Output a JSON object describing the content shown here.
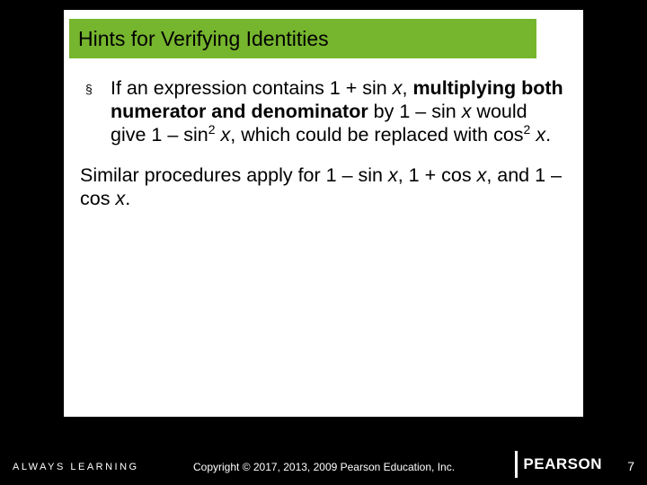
{
  "title": "Hints for Verifying Identities",
  "bullet": {
    "lead": "If an expression contains 1 + sin ",
    "var1": "x",
    "after1": ", ",
    "bold": "multiplying both numerator and denominator",
    "mid": " by 1 – sin ",
    "var2": "x",
    "after2": " would give 1 – sin",
    "sup1": "2",
    "sp1": " ",
    "var3": "x",
    "after3": ", which could be replaced with cos",
    "sup2": "2",
    "sp2": " ",
    "var4": "x",
    "end": "."
  },
  "followup": {
    "t1": "Similar procedures apply for 1 – sin ",
    "v1": "x",
    "t2": ", 1 + cos ",
    "v2": "x",
    "t3": ", and 1 – cos ",
    "v3": "x",
    "t4": "."
  },
  "footer": {
    "always": "ALWAYS LEARNING",
    "copyright": "Copyright © 2017, 2013, 2009 Pearson Education, Inc.",
    "brand": "PEARSON",
    "page": "7"
  },
  "bullet_glyph": "§"
}
